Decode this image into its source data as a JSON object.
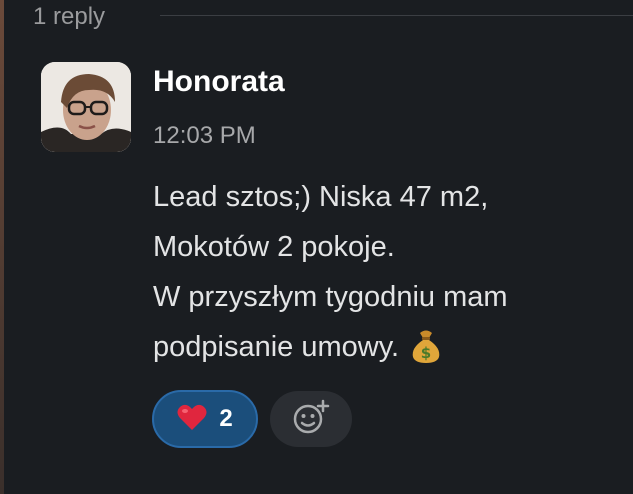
{
  "thread": {
    "reply_count": "1 reply"
  },
  "message": {
    "author": "Honorata",
    "timestamp": "12:03 PM",
    "lines": [
      "Lead sztos;) Niska 47 m2,",
      "Mokotów 2 pokoje.",
      "W przyszłym tygodniu mam",
      "podpisanie umowy."
    ],
    "trailing_emoji": "money-bag-icon"
  },
  "reactions": [
    {
      "emoji": "heart-icon",
      "count": "2",
      "active": true
    }
  ],
  "colors": {
    "background": "#1a1d21",
    "reaction_active": "#1b4e7b",
    "reaction_border": "#2a6aa8"
  }
}
